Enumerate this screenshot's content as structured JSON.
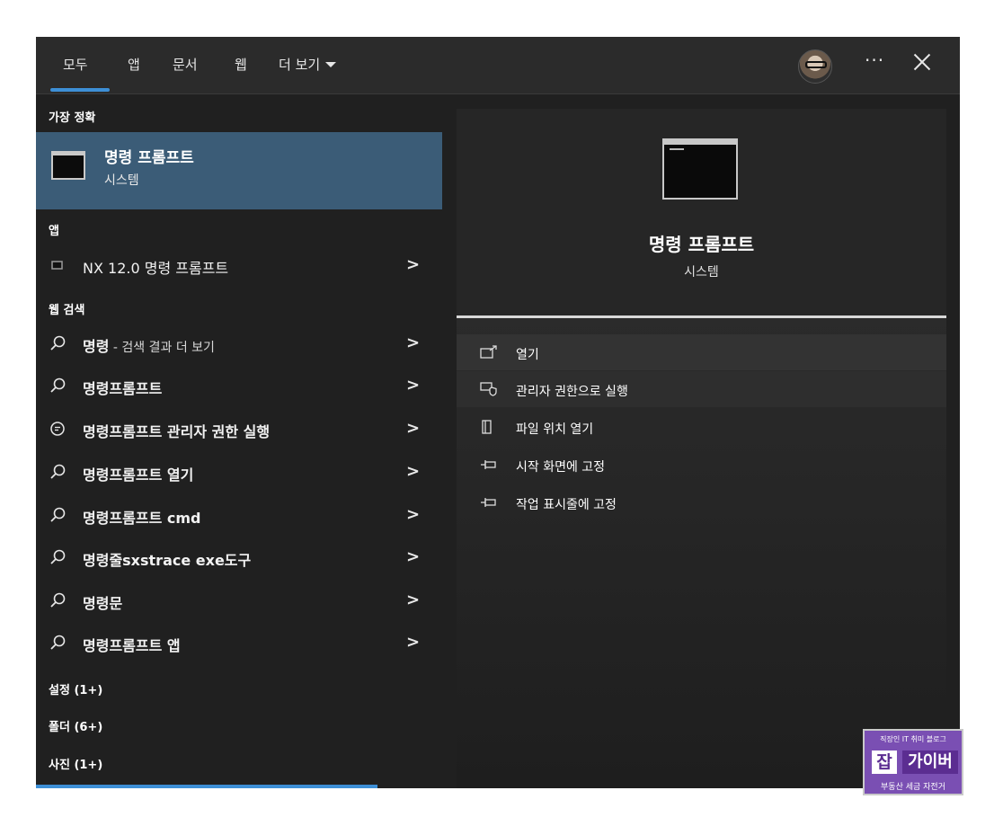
{
  "tabs": [
    {
      "label": "모두",
      "active": true
    },
    {
      "label": "앱"
    },
    {
      "label": "문서"
    },
    {
      "label": "웹"
    },
    {
      "label": "더 보기"
    }
  ],
  "header": {
    "more_label": "···",
    "close_icon": "close-icon",
    "avatar_icon": "avatar"
  },
  "best_match": {
    "section_label": "가장 정확",
    "title": "명령 프롬프트",
    "subtitle": "시스템"
  },
  "apps": {
    "section_label": "앱",
    "items": [
      {
        "label": "NX 12.0 명령 프롬프트",
        "icon": "terminal-icon"
      }
    ]
  },
  "web": {
    "section_label": "웹 검색",
    "items": [
      {
        "label": "명령",
        "suffix": " - 검색 결과 더 보기",
        "icon": "search-icon"
      },
      {
        "label": "명령프롬프트",
        "icon": "search-icon"
      },
      {
        "label": "명령프롬프트 관리자 권한 실행",
        "icon": "chat-icon"
      },
      {
        "label": "명령프롬프트 열기",
        "icon": "search-icon"
      },
      {
        "label": "명령프롬프트 cmd",
        "icon": "search-icon"
      },
      {
        "label": "명령줄sxstrace exe도구",
        "icon": "search-icon"
      },
      {
        "label": "명령문",
        "icon": "search-icon"
      },
      {
        "label": "명령프롬프트 앱",
        "icon": "search-icon"
      }
    ]
  },
  "categories": [
    {
      "label": "설정 (1+)"
    },
    {
      "label": "폴더 (6+)"
    },
    {
      "label": "사진 (1+)"
    }
  ],
  "preview": {
    "title": "명령 프롬프트",
    "subtitle": "시스템",
    "actions": [
      {
        "label": "열기",
        "icon": "open-icon"
      },
      {
        "label": "관리자 권한으로 실행",
        "icon": "shield-icon"
      },
      {
        "label": "파일 위치 열기",
        "icon": "file-location-icon"
      },
      {
        "label": "시작 화면에 고정",
        "icon": "pin-icon"
      },
      {
        "label": "작업 표시줄에 고정",
        "icon": "pin-icon"
      }
    ]
  },
  "watermark": {
    "top": "직장인 IT 취미 블로그",
    "badge": "잡",
    "main": "가이버",
    "bottom": "부동산 세금 자전거"
  },
  "colors": {
    "accent": "#3d8fd6",
    "selection": "#3b5c77",
    "background": "#202020"
  }
}
